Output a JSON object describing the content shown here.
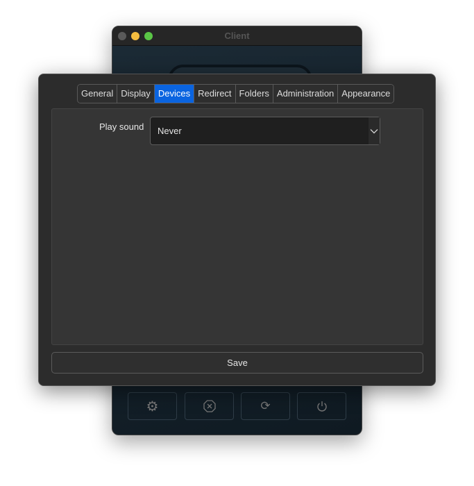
{
  "back_window": {
    "title": "Client",
    "buttons": [
      {
        "icon": "gear-icon"
      },
      {
        "icon": "stop-icon"
      },
      {
        "icon": "refresh-icon"
      },
      {
        "icon": "power-icon"
      }
    ]
  },
  "dialog": {
    "tabs": [
      {
        "label": "General"
      },
      {
        "label": "Display"
      },
      {
        "label": "Devices",
        "active": true
      },
      {
        "label": "Redirect"
      },
      {
        "label": "Folders"
      },
      {
        "label": "Administration"
      },
      {
        "label": "Appearance"
      }
    ],
    "play_sound": {
      "label": "Play sound",
      "value": "Never"
    },
    "save_label": "Save"
  },
  "colors": {
    "accent": "#0a64e0"
  }
}
